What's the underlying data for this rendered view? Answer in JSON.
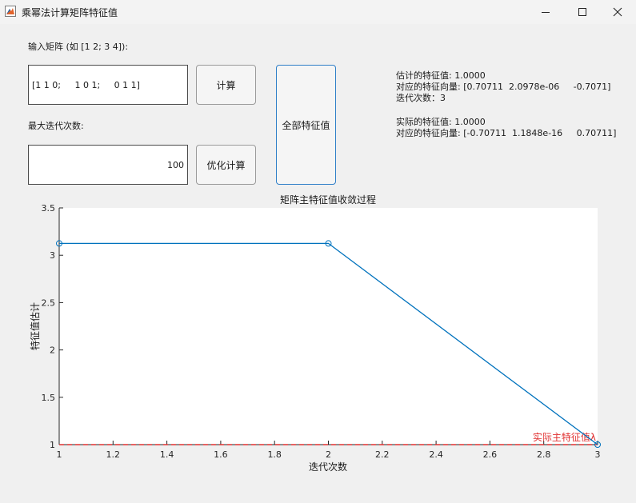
{
  "window": {
    "title": "乘幂法计算矩阵特征值",
    "minimize_icon": "minimize-icon",
    "maximize_icon": "maximize-icon",
    "close_icon": "close-icon"
  },
  "form": {
    "matrix_label": "输入矩阵 (如 [1 2; 3 4]):",
    "matrix_value": "[1 1 0;     1 0 1;     0 1 1]",
    "iter_label": "最大迭代次数:",
    "iter_value": "100",
    "compute_label": "计算",
    "optimize_label": "优化计算",
    "all_eig_label": "全部特征值"
  },
  "results": {
    "estimated_value": "估计的特征值: 1.0000",
    "estimated_vector": "对应的特征向量: [0.70711  2.0978e-06     -0.7071]",
    "iterations": "迭代次数：3",
    "actual_value": "实际的特征值: 1.0000",
    "actual_vector": "对应的特征向量: [-0.70711  1.1848e-16     0.70711]"
  },
  "chart_data": {
    "type": "line",
    "title": "矩阵主特征值收敛过程",
    "xlabel": "迭代次数",
    "ylabel": "特征值估计",
    "xlim": [
      1,
      3
    ],
    "ylim": [
      1,
      3.5
    ],
    "xticks": [
      "1",
      "1.2",
      "1.4",
      "1.6",
      "1.8",
      "2",
      "2.2",
      "2.4",
      "2.6",
      "2.8",
      "3"
    ],
    "yticks": [
      "1",
      "1.5",
      "2",
      "2.5",
      "3",
      "3.5"
    ],
    "series": [
      {
        "x": [
          1,
          2,
          3
        ],
        "values": [
          3.125,
          3.125,
          1.0
        ],
        "color": "#0072bd",
        "marker": "circle"
      }
    ],
    "reference_line": {
      "y": 1.0,
      "color": "#e03030",
      "style": "dashed",
      "label": "实际主特征值λ"
    },
    "grid": false
  }
}
